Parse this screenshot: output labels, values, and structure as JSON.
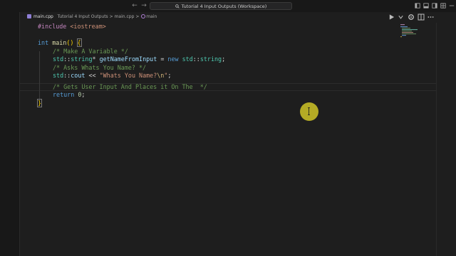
{
  "titlebar": {
    "window_title": "Tutorial 4 Input Outputs (Workspace)",
    "back_icon": "arrow-left-icon",
    "forward_icon": "arrow-right-icon",
    "search_icon": "search-icon"
  },
  "breadcrumb": {
    "file": "main.cpp",
    "folder": "Tutorial 4 Input Outputs",
    "sep": ">",
    "path_file": "main.cpp",
    "symbol": "main"
  },
  "code": {
    "l1": {
      "pre": "#include",
      "inc": "<iostream>"
    },
    "l3": {
      "type": "int",
      "fn": "main",
      "parens": "()",
      "brace": "{"
    },
    "l4": {
      "comment": "/* Make A Variable */"
    },
    "l5": {
      "ns": "std",
      "sep": "::",
      "type": "string",
      "star": "*",
      "var": "getNameFromInput",
      "eq": " = ",
      "kw": "new",
      "ns2": "std",
      "sep2": "::",
      "type2": "string",
      "semi": ";"
    },
    "l6": {
      "comment": "/* Asks Whats You Name? */"
    },
    "l7": {
      "ns": "std",
      "sep": "::",
      "var": "cout",
      "op": " << ",
      "str": "\"Whats You Name?",
      "esc": "\\n",
      "strend": "\"",
      "semi": ";"
    },
    "l8": {
      "comment": "/* Gets User Input And Places it On The  */"
    },
    "l9": {
      "kw": "return",
      "num": "0",
      "semi": ";"
    },
    "l10": {
      "brace": "}"
    }
  },
  "colors": {
    "editor_bg": "#1e1e1e",
    "titlebar_bg": "#181818",
    "pointer_highlight": "#c4ba26"
  }
}
